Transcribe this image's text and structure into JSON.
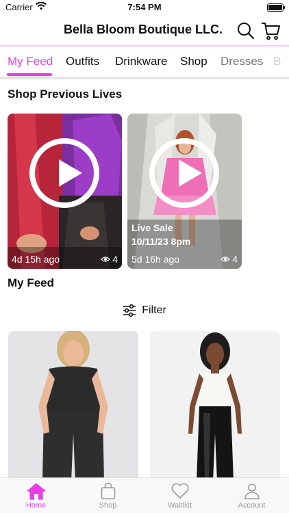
{
  "status_bar": {
    "carrier": "Carrier",
    "time": "7:54 PM"
  },
  "header": {
    "title": "Bella Bloom Boutique LLC."
  },
  "tabs": [
    {
      "label": "My Feed"
    },
    {
      "label": "Outfits"
    },
    {
      "label": "Drinkware"
    },
    {
      "label": "Shop"
    },
    {
      "label": "Dresses"
    },
    {
      "label": "B"
    }
  ],
  "previous_lives": {
    "title": "Shop Previous Lives",
    "cards": [
      {
        "caption_1": "",
        "caption_2": "",
        "ago": "4d 15h ago",
        "views": "4"
      },
      {
        "caption_1": "Live Sale",
        "caption_2": "10/11/23 8pm",
        "ago": "5d 16h ago",
        "views": "4"
      }
    ]
  },
  "feed": {
    "title": "My Feed",
    "filter_label": "Filter"
  },
  "bottom_nav": [
    {
      "label": "Home"
    },
    {
      "label": "Shop"
    },
    {
      "label": "Waitlist"
    },
    {
      "label": "Account"
    }
  ],
  "colors": {
    "accent": "#e83ee8",
    "nav_inactive": "#999999"
  }
}
